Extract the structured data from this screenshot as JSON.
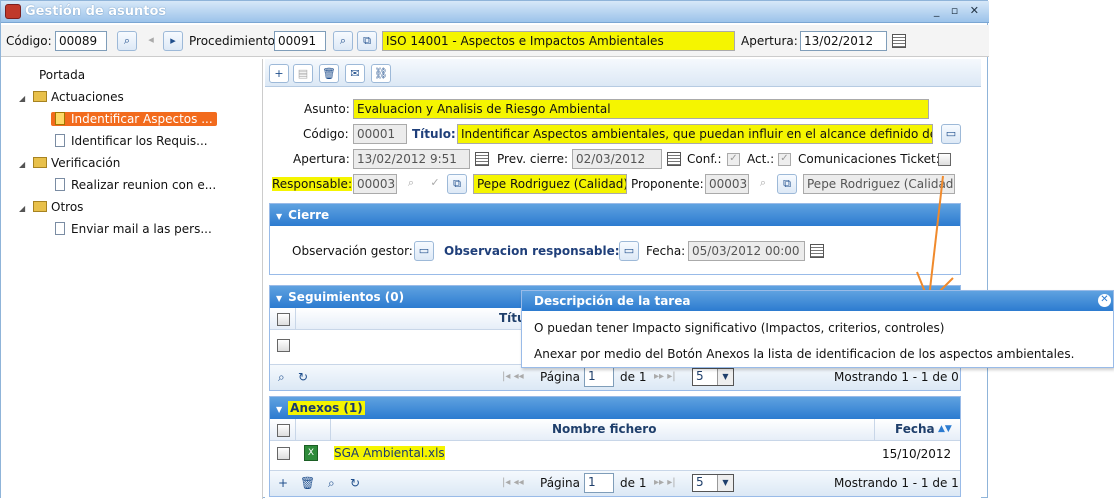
{
  "window": {
    "title": "Gestión de asuntos",
    "controls": "_ ▫ ✕"
  },
  "header": {
    "codigo_label": "Código:",
    "codigo_value": "00089",
    "procedimiento_label": "Procedimiento",
    "procedimiento_code": "00091",
    "procedimiento_name": "ISO 14001 - Aspectos e Impactos Ambientales",
    "apertura_label": "Apertura:",
    "apertura_value": "13/02/2012"
  },
  "tree": {
    "root": "Portada",
    "groups": [
      {
        "label": "Actuaciones",
        "items": [
          "Indentificar Aspectos ...",
          "Identificar los Requis..."
        ]
      },
      {
        "label": "Verificación",
        "items": [
          "Realizar reunion con e..."
        ]
      },
      {
        "label": "Otros",
        "items": [
          "Enviar mail a las pers..."
        ]
      }
    ],
    "selected": "Indentificar Aspectos ..."
  },
  "form": {
    "asunto_label": "Asunto:",
    "asunto_value": "Evaluacion y Analisis de Riesgo Ambiental",
    "codigo_label": "Código:",
    "codigo_value": "00001",
    "titulo_label": "Título:",
    "titulo_value": "Indentificar Aspectos ambientales, que puedan influir en el alcance definido del sis",
    "apertura_label": "Apertura:",
    "apertura_value": "13/02/2012 9:51",
    "prev_cierre_label": "Prev. cierre:",
    "prev_cierre_value": "02/03/2012",
    "conf_label": "Conf.:",
    "act_label": "Act.:",
    "comunicaciones_label": "Comunicaciones Ticket:",
    "responsable_label": "Responsable:",
    "responsable_code": "00003",
    "responsable_name": "Pepe Rodriguez (Calidad)",
    "proponente_label": "Proponente:",
    "proponente_code": "00003",
    "proponente_name": "Pepe Rodriguez (Calidad)"
  },
  "cierre": {
    "title": "Cierre",
    "obs_gestor_label": "Observación gestor:",
    "obs_resp_label": "Observacion responsable:",
    "fecha_label": "Fecha:",
    "fecha_value": "05/03/2012 00:00"
  },
  "seguimientos": {
    "title": "Seguimientos (0)",
    "col_titulo": "Títu",
    "pagina_label": "Página",
    "page": "1",
    "de_label": "de 1",
    "page_size": "5",
    "mostrando": "Mostrando 1 - 1 de 0"
  },
  "anexos": {
    "title": "Anexos (1)",
    "col_nombre": "Nombre fichero",
    "col_fecha": "Fecha",
    "rows": [
      {
        "nombre": "SGA Ambiental.xls",
        "fecha": "15/10/2012"
      }
    ],
    "pagina_label": "Página",
    "page": "1",
    "de_label": "de 1",
    "page_size": "5",
    "mostrando": "Mostrando 1 - 1 de 1"
  },
  "popup": {
    "title": "Descripción de la tarea",
    "line1": "O puedan tener Impacto significativo (Impactos, criterios, controles)",
    "line2": "Anexar por medio del Botón Anexos la lista de identificacion de los aspectos ambientales."
  },
  "colors": {
    "accent": "#2c7bd0",
    "highlight": "#f5f500",
    "selected": "#f26b1d",
    "arrow": "#f08a2c"
  }
}
